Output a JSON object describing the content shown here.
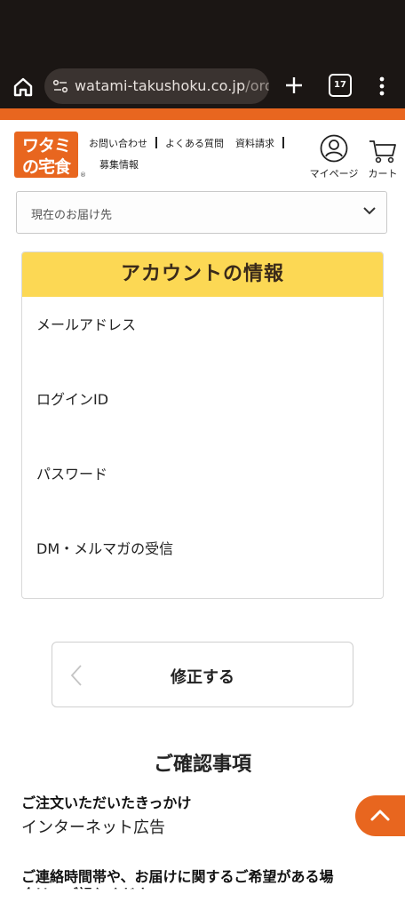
{
  "browser": {
    "url_main": "watami-takushoku.co.jp",
    "url_tail": "/orde",
    "tab_count": "17"
  },
  "header": {
    "logo_line1": "ワタミ",
    "logo_line2": "の宅食",
    "logo_reg": "®",
    "nav": {
      "contact": "お問い合わせ",
      "faq": "よくある質問",
      "brochure": "資料請求",
      "recruit": "募集情報"
    },
    "mypage_label": "マイページ",
    "cart_label": "カート"
  },
  "delivery": {
    "label": "現在のお届け先"
  },
  "account": {
    "title": "アカウントの情報",
    "rows": [
      "メールアドレス",
      "ログインID",
      "パスワード",
      "DM・メルマガの受信"
    ]
  },
  "edit_button": {
    "label": "修正する"
  },
  "confirm": {
    "title": "ご確認事項",
    "q1": "ご注文いただいたきっかけ",
    "a1": "インターネット広告",
    "q2": "ご連絡時間帯や、お届けに関するご希望がある場",
    "q2_cont": "合は、ご記入ください"
  },
  "colors": {
    "brand_orange": "#e8661f",
    "account_header": "#fcd854",
    "browser_bg": "#1b1614"
  }
}
